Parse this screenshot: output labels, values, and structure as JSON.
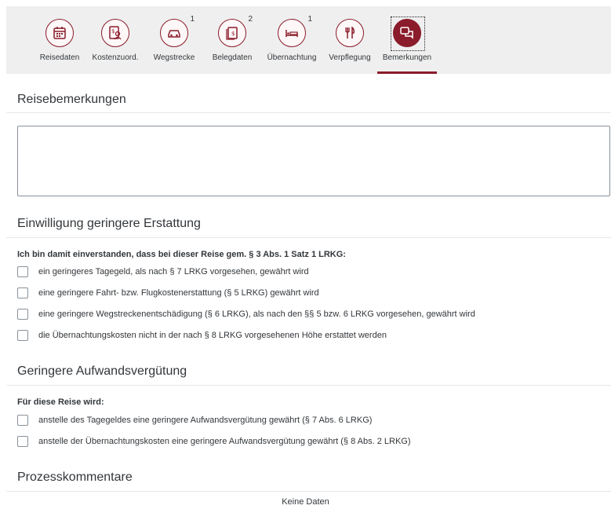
{
  "stepper": {
    "steps": [
      {
        "label": "Reisedaten",
        "icon": "calendar-icon",
        "badge": ""
      },
      {
        "label": "Kostenzuord.",
        "icon": "cost-assignment-icon",
        "badge": ""
      },
      {
        "label": "Wegstrecke",
        "icon": "car-icon",
        "badge": "1"
      },
      {
        "label": "Belegdaten",
        "icon": "receipt-icon",
        "badge": "2"
      },
      {
        "label": "Übernachtung",
        "icon": "bed-icon",
        "badge": "1"
      },
      {
        "label": "Verpflegung",
        "icon": "cutlery-icon",
        "badge": ""
      },
      {
        "label": "Bemerkungen",
        "icon": "comments-icon",
        "badge": ""
      }
    ],
    "active_step": "Bemerkungen",
    "accent": "#8a1c2b"
  },
  "remarks": {
    "title": "Reisebemerkungen",
    "value": ""
  },
  "consent": {
    "title": "Einwilligung geringere Erstattung",
    "intro": "Ich bin damit einverstanden, dass bei dieser Reise gem. § 3 Abs. 1 Satz 1 LRKG:",
    "options": [
      {
        "label": "ein geringeres Tagegeld, als nach § 7 LRKG vorgesehen, gewährt wird",
        "checked": false
      },
      {
        "label": "eine geringere Fahrt- bzw. Flugkostenerstattung (§ 5 LRKG) gewährt wird",
        "checked": false
      },
      {
        "label": "eine geringere Wegstreckenentschädigung (§ 6 LRKG), als nach den §§ 5 bzw. 6 LRKG vorgesehen, gewährt wird",
        "checked": false
      },
      {
        "label": "die Übernachtungskosten nicht in der nach § 8 LRKG vorgesehenen Höhe erstattet werden",
        "checked": false
      }
    ]
  },
  "allowance": {
    "title": "Geringere Aufwandsvergütung",
    "intro": "Für diese Reise wird:",
    "options": [
      {
        "label": "anstelle des Tagegeldes eine geringere Aufwandsvergütung gewährt (§ 7 Abs. 6 LRKG)",
        "checked": false
      },
      {
        "label": "anstelle der Übernachtungskosten eine geringere Aufwandsvergütung gewährt (§ 8 Abs. 2 LRKG)",
        "checked": false
      }
    ]
  },
  "process_comments": {
    "title": "Prozesskommentare",
    "empty_text": "Keine Daten"
  }
}
